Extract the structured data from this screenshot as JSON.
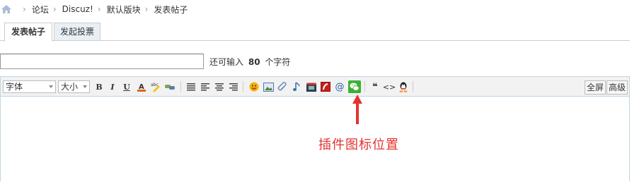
{
  "breadcrumb": {
    "home_icon": "home-icon",
    "items": [
      "论坛",
      "Discuz!",
      "默认版块",
      "发表帖子"
    ],
    "separator": "›"
  },
  "tabs": [
    {
      "label": "发表帖子",
      "active": true
    },
    {
      "label": "发起投票",
      "active": false
    }
  ],
  "subject": {
    "value": "",
    "hint_prefix": "还可输入",
    "hint_count": "80",
    "hint_suffix": "个字符"
  },
  "toolbar": {
    "font_select": "字体",
    "size_select": "大小",
    "bold": "B",
    "italic": "I",
    "underline": "U",
    "quote_glyph": "❝",
    "code_glyph": "<>",
    "fullscreen": "全屏",
    "advanced": "高级"
  },
  "annotation": {
    "text": "插件图标位置",
    "color": "#e5322d"
  },
  "colors": {
    "tab_bg": "#e8eff5",
    "border": "#cdcdcd",
    "editor_border": "#c2d5e3",
    "toolbar_bg": "#f2f2f2",
    "wechat_green": "#3cb034"
  }
}
